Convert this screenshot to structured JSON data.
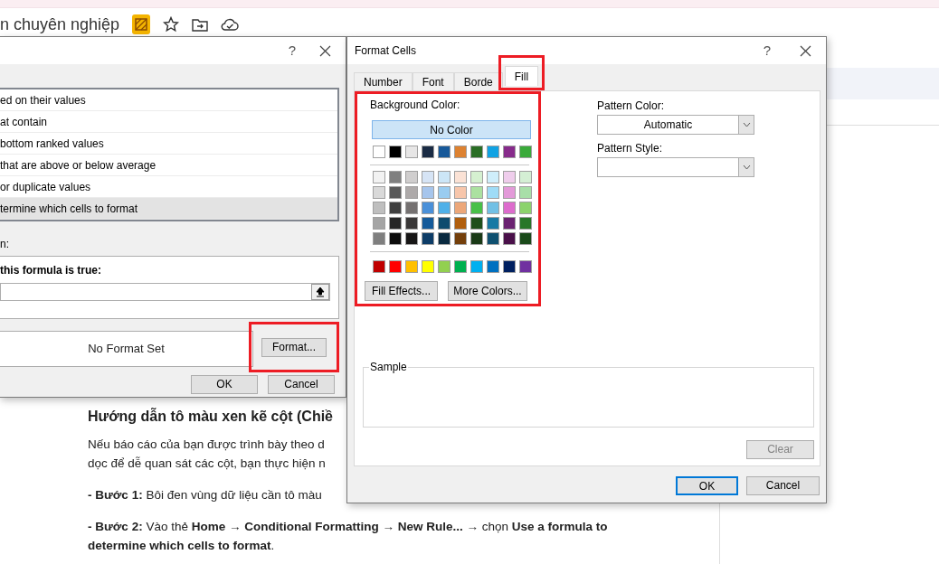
{
  "page": {
    "title_fragment": "n chuyên nghiệp",
    "heading": "Hướng dẫn tô màu xen kẽ cột (Chiề",
    "paragraph_lines": [
      "Nếu báo cáo của bạn được trình bày theo d",
      "dọc để dễ quan sát các cột, bạn thực hiện n"
    ],
    "steps": [
      "**- Bước 1:** Bôi đen vùng dữ liệu cần tô màu",
      "**- Bước 2:** Vào thẻ **Home** → **Conditional Formatting** → **New Rule...** → chọn **Use a formula to determine which cells to format**."
    ]
  },
  "rule_dialog": {
    "help": "?",
    "rule_types": [
      {
        "label": "ed on their values",
        "selected": false
      },
      {
        "label": "at contain",
        "selected": false
      },
      {
        "label": "bottom ranked values",
        "selected": false
      },
      {
        "label": "that are above or below average",
        "selected": false
      },
      {
        "label": "or duplicate values",
        "selected": false
      },
      {
        "label": "termine which cells to format",
        "selected": true
      }
    ],
    "section_label": "n:",
    "formula_label": "this formula is true:",
    "preview": "No Format Set",
    "format_button": {
      "label": "Format...",
      "highlighted": true
    },
    "buttons": [
      "OK",
      "Cancel"
    ]
  },
  "format_cells": {
    "title": "Format Cells",
    "help": "?",
    "tabs": [
      {
        "label": "Number",
        "selected": false,
        "highlighted": false
      },
      {
        "label": "Font",
        "selected": false,
        "highlighted": false
      },
      {
        "label": "Borde",
        "selected": false,
        "highlighted": false
      },
      {
        "label": "Fill",
        "selected": true,
        "highlighted": true
      }
    ],
    "background_color": {
      "label": "Background Color:",
      "highlighted": true,
      "no_color": {
        "label": "No Color",
        "selected": true
      },
      "basic_colors": [
        {
          "color": "#ffffff"
        },
        {
          "color": "#000000"
        },
        {
          "color": "#e7e6e6"
        },
        {
          "color": "#1a2b44"
        },
        {
          "color": "#17599a"
        },
        {
          "color": "#dd8231"
        },
        {
          "color": "#2a6e25"
        },
        {
          "color": "#10a2e3"
        },
        {
          "color": "#872b8b"
        },
        {
          "color": "#3aaa3a"
        }
      ],
      "theme_colors": [
        [
          {
            "color": "#f2f2f2"
          },
          {
            "color": "#7f7f7f"
          },
          {
            "color": "#d0cece"
          },
          {
            "color": "#d6e4f5"
          },
          {
            "color": "#cce6f7"
          },
          {
            "color": "#fbe2d5"
          },
          {
            "color": "#d5f0d0"
          },
          {
            "color": "#cfeefb"
          },
          {
            "color": "#efcdec"
          },
          {
            "color": "#d4efd4"
          }
        ],
        [
          {
            "color": "#d9d9d9"
          },
          {
            "color": "#595959"
          },
          {
            "color": "#aeaaaa"
          },
          {
            "color": "#a6c5ec"
          },
          {
            "color": "#99ccf0"
          },
          {
            "color": "#f7c6ab"
          },
          {
            "color": "#abe1a0"
          },
          {
            "color": "#9fdcf7"
          },
          {
            "color": "#e39ad9"
          },
          {
            "color": "#a8dfa8"
          }
        ],
        [
          {
            "color": "#bfbfbf"
          },
          {
            "color": "#3f3f3f"
          },
          {
            "color": "#757171"
          },
          {
            "color": "#4a90d9"
          },
          {
            "color": "#4fb0e8"
          },
          {
            "color": "#eca779"
          },
          {
            "color": "#48c048"
          },
          {
            "color": "#72c0e5"
          },
          {
            "color": "#dd6ccd"
          },
          {
            "color": "#8cd36c"
          }
        ],
        [
          {
            "color": "#a5a5a5"
          },
          {
            "color": "#262626"
          },
          {
            "color": "#3a3838"
          },
          {
            "color": "#145a9a"
          },
          {
            "color": "#0e4b6e"
          },
          {
            "color": "#b05e0d"
          },
          {
            "color": "#1f4f1b"
          },
          {
            "color": "#1879a4"
          },
          {
            "color": "#6b2271"
          },
          {
            "color": "#277728"
          }
        ],
        [
          {
            "color": "#7f7f7f"
          },
          {
            "color": "#0c0c0c"
          },
          {
            "color": "#171616"
          },
          {
            "color": "#0d3c67"
          },
          {
            "color": "#0a2a40"
          },
          {
            "color": "#743f0b"
          },
          {
            "color": "#1a3a17"
          },
          {
            "color": "#0f5070"
          },
          {
            "color": "#4a104a"
          },
          {
            "color": "#1a4a1a"
          }
        ]
      ],
      "standard_colors": [
        {
          "color": "#c00000"
        },
        {
          "color": "#ff0000"
        },
        {
          "color": "#ffc000"
        },
        {
          "color": "#ffff00"
        },
        {
          "color": "#92d050"
        },
        {
          "color": "#00b050"
        },
        {
          "color": "#00b0f0"
        },
        {
          "color": "#0070c0"
        },
        {
          "color": "#002060"
        },
        {
          "color": "#7030a0"
        }
      ],
      "fill_effects": "Fill Effects...",
      "more_colors": "More Colors..."
    },
    "pattern_color": {
      "label": "Pattern Color:",
      "value": "Automatic"
    },
    "pattern_style": {
      "label": "Pattern Style:"
    },
    "sample_label": "Sample",
    "clear_button": {
      "label": "Clear",
      "disabled": true
    },
    "buttons": [
      {
        "label": "OK",
        "default": true
      },
      {
        "label": "Cancel",
        "default": false
      }
    ]
  }
}
